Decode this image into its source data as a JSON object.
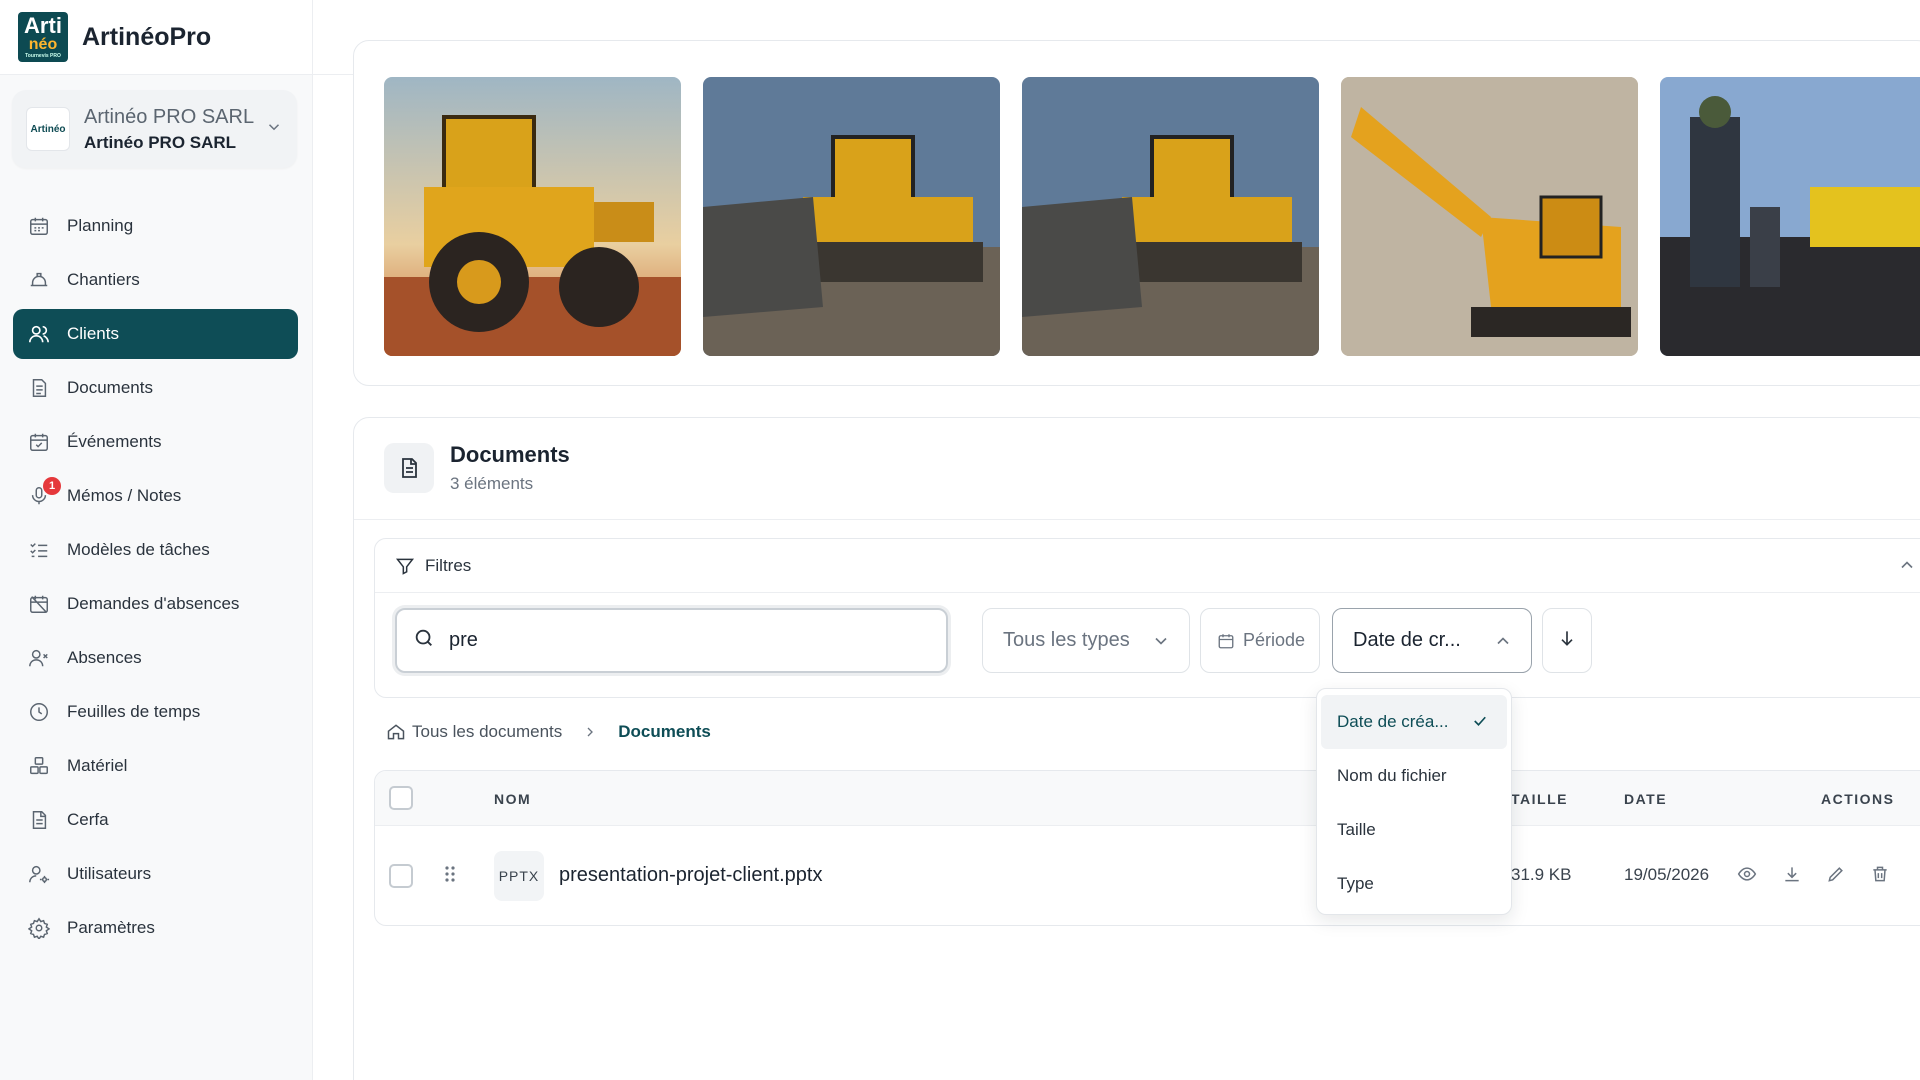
{
  "app": {
    "brand_name": "ArtinéoPro",
    "logo_line1": "Arti",
    "logo_line2": "néo",
    "logo_line3": "Tournevis PRO"
  },
  "organization": {
    "line1": "Artinéo PRO SARL",
    "line2": "Artinéo PRO SARL",
    "logo_text": "Artinéo"
  },
  "sidebar": {
    "items": [
      {
        "label": "Planning",
        "icon": "calendar-icon"
      },
      {
        "label": "Chantiers",
        "icon": "hardhat-icon"
      },
      {
        "label": "Clients",
        "icon": "users-icon",
        "active": true
      },
      {
        "label": "Documents",
        "icon": "document-icon"
      },
      {
        "label": "Événements",
        "icon": "calendar-check-icon"
      },
      {
        "label": "Mémos / Notes",
        "icon": "microphone-icon",
        "badge": "1"
      },
      {
        "label": "Modèles de tâches",
        "icon": "checklist-icon"
      },
      {
        "label": "Demandes d'absences",
        "icon": "calendar-off-icon"
      },
      {
        "label": "Absences",
        "icon": "user-x-icon"
      },
      {
        "label": "Feuilles de temps",
        "icon": "clock-icon"
      },
      {
        "label": "Matériel",
        "icon": "boxes-icon"
      },
      {
        "label": "Cerfa",
        "icon": "file-text-icon"
      },
      {
        "label": "Utilisateurs",
        "icon": "user-cog-icon"
      },
      {
        "label": "Paramètres",
        "icon": "gear-icon"
      }
    ]
  },
  "documents": {
    "title": "Documents",
    "count": "3 éléments",
    "filters_label": "Filtres",
    "search": {
      "value": "pre",
      "placeholder": ""
    },
    "type_select": "Tous les types",
    "periode": "Période",
    "sort_select": "Date de cr...",
    "breadcrumb": {
      "root": "Tous les documents",
      "current": "Documents"
    },
    "table": {
      "headers": {
        "name": "NOM",
        "size": "TAILLE",
        "date": "DATE",
        "actions": "ACTIONS"
      },
      "rows": [
        {
          "ext": "PPTX",
          "name": "presentation-projet-client.pptx",
          "size": "31.9 KB",
          "date": "19/05/2026"
        }
      ]
    },
    "sort_options": [
      {
        "label": "Date de créa...",
        "selected": true
      },
      {
        "label": "Nom du fichier"
      },
      {
        "label": "Taille"
      },
      {
        "label": "Type"
      }
    ]
  },
  "colors": {
    "accent": "#0e4d56",
    "badge": "#e5383b"
  }
}
